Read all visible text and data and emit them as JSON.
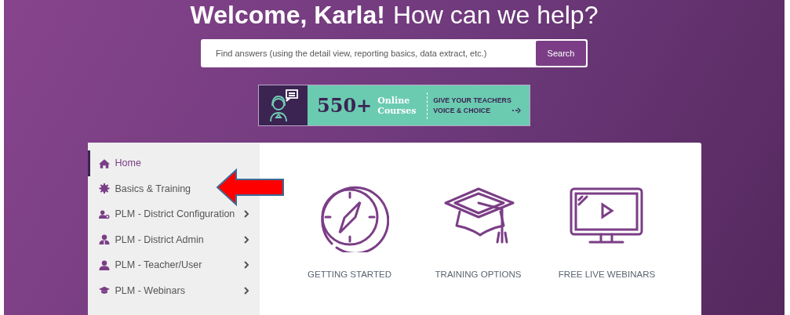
{
  "heading": {
    "greeting": "Welcome, Karla!",
    "question": "How can we help?"
  },
  "search": {
    "placeholder": "Find answers (using the detail view, reporting basics, data extract, etc.)",
    "button": "Search"
  },
  "banner": {
    "number": "550+",
    "courses": "Online Courses",
    "tagline": "GIVE YOUR TEACHERS VOICE & CHOICE"
  },
  "menu": [
    {
      "label": "Home",
      "selected": true,
      "has_submenu": false
    },
    {
      "label": "Basics & Training",
      "selected": false,
      "has_submenu": false
    },
    {
      "label": "PLM - District Configuration",
      "selected": false,
      "has_submenu": true
    },
    {
      "label": "PLM - District Admin",
      "selected": false,
      "has_submenu": true
    },
    {
      "label": "PLM - Teacher/User",
      "selected": false,
      "has_submenu": true
    },
    {
      "label": "PLM - Webinars",
      "selected": false,
      "has_submenu": true
    }
  ],
  "cards": [
    {
      "kind": "compass",
      "label": "GETTING STARTED"
    },
    {
      "kind": "graduation-cap",
      "label": "TRAINING OPTIONS"
    },
    {
      "kind": "monitor",
      "label": "FREE LIVE WEBINARS"
    }
  ]
}
